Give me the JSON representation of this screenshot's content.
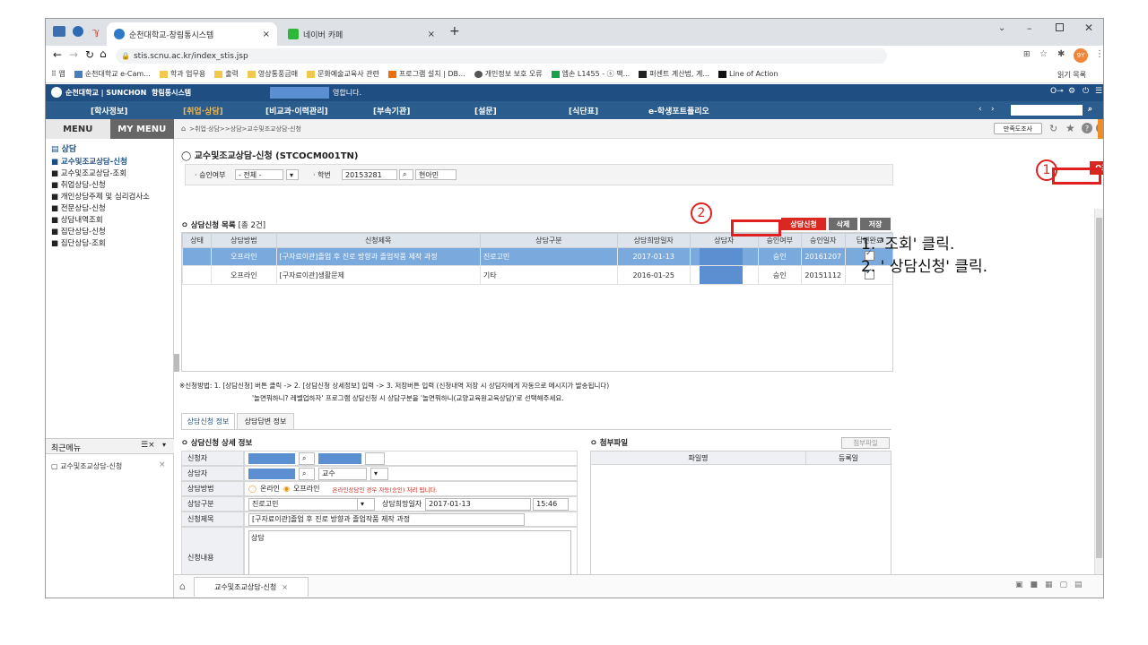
{
  "browser": {
    "tabs": [
      {
        "label": "순천대학교-창림통시스템",
        "active": true
      },
      {
        "label": "네이버 카페",
        "active": false
      }
    ],
    "new_tab": "+",
    "url": "stis.scnu.ac.kr/index_stis.jsp",
    "bookmarks": [
      "앱",
      "순천대학교 e-Cam...",
      "학과 업무용",
      "출력",
      "영상통풍금매",
      "문화예술교육사 관련",
      "프로그램 설치 | DB...",
      "개인정보 보호 오류",
      "엡손 L1455 - ⓢ 팩...",
      "퍼센트 계산법, 계...",
      "Line of Action"
    ],
    "reading_list": "읽기 목록",
    "profile": "9Y"
  },
  "app": {
    "logo": "순천대학교 | SUNCHON",
    "system": "항림통시스템",
    "welcome": "영합니다.",
    "menus": [
      "[학사정보]",
      "[취업·상담]",
      "[비교과·이력관리]",
      "[부속기관]",
      "[설문]",
      "[식단표]",
      "e-학생포트폴리오"
    ]
  },
  "sidebar": {
    "tabs": [
      "MENU",
      "MY MENU"
    ],
    "section": "상담",
    "items": [
      "교수및조교상담-신청",
      "교수및조교상담-조회",
      "취업상담-신청",
      "개인상담주제 및 심리검사소",
      "전문상담-신청",
      "상담내역조회",
      "집단상담-신청",
      "집단상담-조회"
    ],
    "recent_title": "최근메뉴",
    "recent_items": [
      "교수및조교상담-신청"
    ]
  },
  "content": {
    "breadcrumb": ">취업·상담>>상담>교수및조교상담-신청",
    "satisfaction": "만족도조사",
    "page_title": "교수및조교상담-신청 (STCOCM001TN)",
    "search_btn": "Q조회",
    "filter": {
      "approval_label": "· 승인여부",
      "approval_value": "- 전체 -",
      "student_label": "· 학번",
      "student_id": "20153281",
      "student_name": "현아민"
    },
    "list_title": "상담신청 목록",
    "list_count": "[총 2건]",
    "buttons": {
      "apply": "상담신청",
      "delete": "삭제",
      "save": "저장"
    },
    "columns": [
      "상태",
      "상담방법",
      "신청제목",
      "상담구분",
      "상담희망일자",
      "상담자",
      "승인여부",
      "승인일자",
      "답변완료"
    ],
    "rows": [
      {
        "status": "",
        "method": "오프라인",
        "title": "[구자료이관]졸업 후 진로 방향과 졸업작품 제작 과정",
        "category": "진로고민",
        "date": "2017-01-13",
        "counselor": "",
        "approval": "승인",
        "approved_date": "20161207",
        "done": true
      },
      {
        "status": "",
        "method": "오프라인",
        "title": "[구자료이관]생활문제",
        "category": "기타",
        "date": "2016-01-25",
        "counselor": "",
        "approval": "승인",
        "approved_date": "20151112",
        "done": true
      }
    ],
    "note1": "※신청방법: 1. [상담신청] 버튼 클릭 -> 2. [상담신청 상세정보] 입력 -> 3. 저장버튼 입력 (신청내역 저장 시 상담자에게 자동으로 메시지가 발송됩니다)",
    "note2": "'놀면뭐하니? 레벨업하자' 프로그램 상담신청 시 상담구분을 '놀면뭐하니(교양교육원교육상담)'로 선택해주세요.",
    "detail_tabs": [
      "상담신청 정보",
      "상담답변 정보"
    ],
    "detail_title": "상담신청 상세 정보",
    "fields": {
      "applicant": "신청자",
      "counselor": "상담자",
      "counselor_role": "교수",
      "method": "상담방법",
      "method_online": "온라인",
      "method_offline": "오프라인",
      "method_note": "온라인상담인 경우 자동(승인) 처리 됩니다.",
      "category": "상담구분",
      "category_value": "진로고민",
      "hope_date_label": "상담희망일자",
      "hope_date": "2017-01-13",
      "hope_time": "15:46",
      "title": "신청제목",
      "title_value": "[구자료이관]졸업 후 진로 방향과 졸업작품 제작 과정",
      "body": "신청내용",
      "body_value": "상담"
    },
    "attach_title": "첨부파일",
    "attach_btn": "첨부파일",
    "attach_cols": [
      "파일명",
      "등록일"
    ],
    "bottom_tab": "교수및조교상담-신청"
  },
  "annotations": {
    "marker1": "1",
    "marker2": "2",
    "step1": "1.  '조회' 클릭.",
    "step2": "2.   ' 상담신청' 클릭.",
    "highlight_color": "#e02020"
  }
}
